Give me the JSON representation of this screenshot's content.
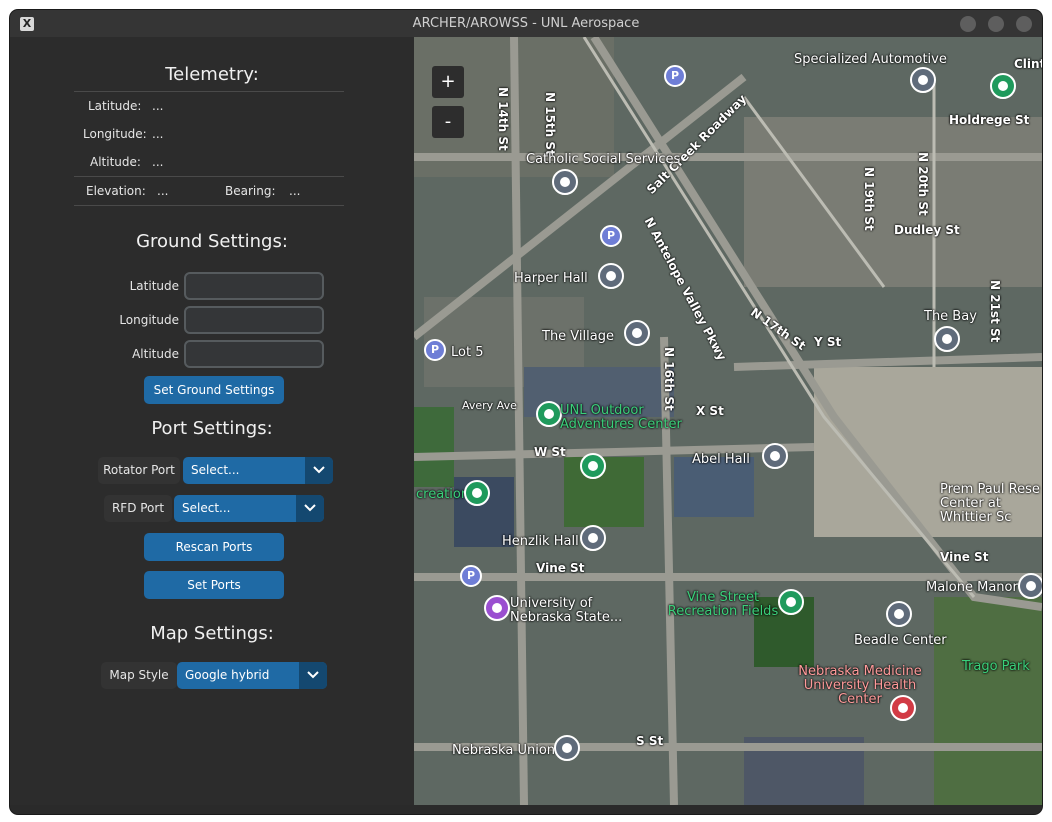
{
  "window": {
    "title": "ARCHER/AROWSS - UNL Aerospace",
    "app_icon": "x-icon"
  },
  "telemetry": {
    "title": "Telemetry:",
    "latitude_label": "Latitude:",
    "latitude_value": "...",
    "longitude_label": "Longitude:",
    "longitude_value": "...",
    "altitude_label": "Altitude:",
    "altitude_value": "...",
    "elevation_label": "Elevation:",
    "elevation_value": "...",
    "bearing_label": "Bearing:",
    "bearing_value": "..."
  },
  "ground_settings": {
    "title": "Ground Settings:",
    "latitude_label": "Latitude",
    "latitude_value": "",
    "longitude_label": "Longitude",
    "longitude_value": "",
    "altitude_label": "Altitude",
    "altitude_value": "",
    "set_button": "Set Ground Settings"
  },
  "port_settings": {
    "title": "Port Settings:",
    "rotator_label": "Rotator Port",
    "rotator_value": "Select...",
    "rfd_label": "RFD Port",
    "rfd_value": "Select...",
    "rescan_button": "Rescan Ports",
    "set_button": "Set Ports"
  },
  "map_settings": {
    "title": "Map Settings:",
    "style_label": "Map Style",
    "style_value": "Google hybrid"
  },
  "map": {
    "zoom_in": "+",
    "zoom_out": "-",
    "streets": [
      {
        "text": "N 14th St"
      },
      {
        "text": "N 15th St"
      },
      {
        "text": "Salt Creek Roadway"
      },
      {
        "text": "N Antelope Valley Pkwy"
      },
      {
        "text": "N 17th St"
      },
      {
        "text": "N 19th St"
      },
      {
        "text": "N 20th St"
      },
      {
        "text": "Holdrege St"
      },
      {
        "text": "Dudley St"
      },
      {
        "text": "Y St"
      },
      {
        "text": "X St"
      },
      {
        "text": "W St"
      },
      {
        "text": "Avery Ave"
      },
      {
        "text": "N 16th St"
      },
      {
        "text": "Vine St"
      },
      {
        "text": "S St"
      },
      {
        "text": "N 21st St"
      },
      {
        "text": "Clinto"
      }
    ],
    "places": [
      {
        "text": "Specialized Automotive"
      },
      {
        "text": "Catholic Social Services"
      },
      {
        "text": "Harper Hall"
      },
      {
        "text": "The Village"
      },
      {
        "text": "Lot 5"
      },
      {
        "text": "UNL Outdoor Adventures Center"
      },
      {
        "text": "Abel Hall"
      },
      {
        "text": "creation"
      },
      {
        "text": "Henzlik Hall"
      },
      {
        "text": "University of Nebraska State..."
      },
      {
        "text": "Vine Street Recreation Fields"
      },
      {
        "text": "Beadle Center"
      },
      {
        "text": "Nebraska Medicine University Health Center"
      },
      {
        "text": "Nebraska Union"
      },
      {
        "text": "The Bay"
      },
      {
        "text": "Prem Paul Rese Center at Whittier Sc"
      },
      {
        "text": "Malone Manor"
      },
      {
        "text": "Trago Park"
      }
    ]
  }
}
